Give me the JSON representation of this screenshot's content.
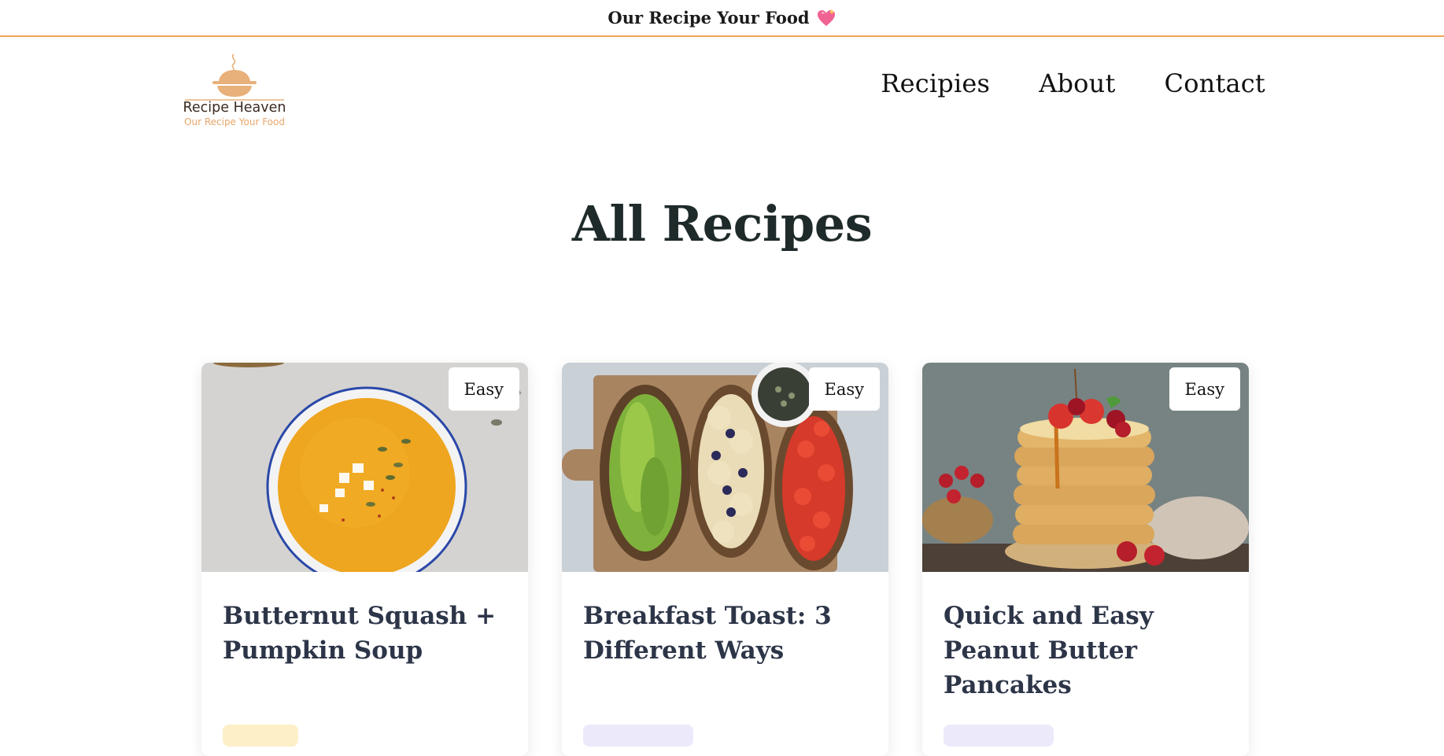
{
  "topbar": {
    "text": "Our Recipe Your Food",
    "icon": "sparkling-heart-icon"
  },
  "header": {
    "logo": {
      "name": "Recipe Heaven",
      "tagline": "Our Recipe Your Food",
      "icon": "pie-dish-icon",
      "colors": {
        "dish": "#e8b07a",
        "name": "#3b2a20",
        "tagline": "#e7a66a"
      }
    },
    "nav": [
      {
        "label": "Recipies"
      },
      {
        "label": "About"
      },
      {
        "label": "Contact"
      }
    ]
  },
  "main": {
    "title": "All Recipes",
    "recipes": [
      {
        "title": "Butternut Squash + Pumpkin Soup",
        "difficulty": "Easy",
        "image": "pumpkin-soup-photo",
        "tag_color": "#fdefc8"
      },
      {
        "title": "Breakfast Toast: 3 Different Ways",
        "difficulty": "Easy",
        "image": "breakfast-toast-photo",
        "tag_color": "#ece9fb"
      },
      {
        "title": "Quick and Easy Peanut Butter Pancakes",
        "difficulty": "Easy",
        "image": "pancakes-photo",
        "tag_color": "#ece9fb"
      }
    ]
  },
  "colors": {
    "accent": "#f0a35a",
    "title_text": "#2d3548"
  }
}
